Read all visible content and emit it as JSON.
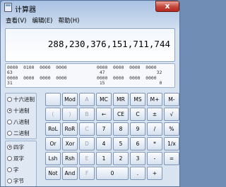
{
  "window": {
    "title": "计算器",
    "close_label": "x"
  },
  "menu": [
    "查看(V)",
    "编辑(E)",
    "帮助(H)"
  ],
  "display": {
    "value": "288,230,376,151,711,744"
  },
  "bits": {
    "row1": "0000  0100  0000  0000           0000  0000  0000  0000",
    "row2": "63                                47                   32",
    "row3": "0000  0000  0000  0000           0000  0000  0000  0000",
    "row4": "31                                15                    0"
  },
  "base_radios": [
    {
      "label": "十六进制",
      "selected": false
    },
    {
      "label": "十进制",
      "selected": true
    },
    {
      "label": "八进制",
      "selected": false
    },
    {
      "label": "二进制",
      "selected": false
    }
  ],
  "word_radios": [
    {
      "label": "四字",
      "selected": true
    },
    {
      "label": "双字",
      "selected": false
    },
    {
      "label": "字",
      "selected": false
    },
    {
      "label": "字节",
      "selected": false
    }
  ],
  "keys": {
    "r1": [
      "",
      "Mod",
      "A",
      "MC",
      "MR",
      "MS",
      "M+",
      "M-"
    ],
    "r2": [
      "(",
      ")",
      "B",
      "←",
      "CE",
      "C",
      "±",
      "√"
    ],
    "r3": [
      "RoL",
      "RoR",
      "C",
      "7",
      "8",
      "9",
      "/",
      "%"
    ],
    "r4": [
      "Or",
      "Xor",
      "D",
      "4",
      "5",
      "6",
      "*",
      "1/x"
    ],
    "r5": [
      "Lsh",
      "Rsh",
      "E",
      "1",
      "2",
      "3",
      "-",
      "="
    ],
    "r6": [
      "Not",
      "And",
      "F",
      "0",
      ".",
      "+"
    ]
  }
}
